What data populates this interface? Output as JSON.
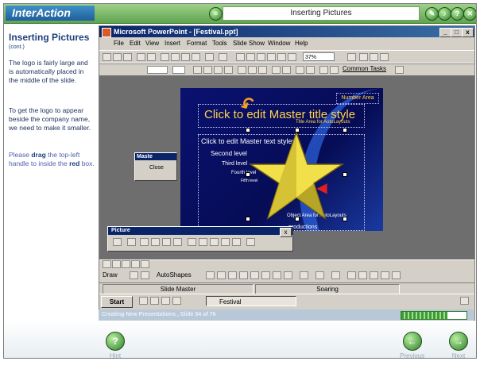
{
  "app": {
    "brand": "InterAction",
    "lesson_title": "Inserting Pictures"
  },
  "top_icons": [
    "pin-icon",
    "audio-icon",
    "help-icon",
    "close-icon"
  ],
  "left_panel": {
    "title": "Inserting Pictures",
    "subtitle": "(cont.)",
    "para1": "The logo is fairly large and is automatically placed in the middle of the slide.",
    "para2": "To get the logo to appear beside the company name, we need to make it smaller.",
    "para3_prefix": "Please ",
    "para3_drag": "drag",
    "para3_mid": " the top-left handle to inside the ",
    "para3_red": "red",
    "para3_end": " box."
  },
  "ppt": {
    "title": "Microsoft PowerPoint - [Festival.ppt]",
    "menu": [
      "File",
      "Edit",
      "View",
      "Insert",
      "Format",
      "Tools",
      "Slide Show",
      "Window",
      "Help"
    ],
    "zoom": "37%",
    "common_tasks": "Common Tasks"
  },
  "slide": {
    "number_area": "Number Area",
    "title": "Click to edit Master title style",
    "title_area": "Title Area for AutoLayouts",
    "bullets": [
      "Click to edit Master text styles",
      "Second level",
      "Third level",
      "Fourth level",
      "Fifth level"
    ],
    "object_area": "Object Area for AutoLayouts",
    "footer_text": "productions"
  },
  "master_toolbar": {
    "title": "Maste",
    "close_label": "Close"
  },
  "picture_toolbar": {
    "title": "Picture"
  },
  "draw_toolbar": {
    "draw_label": "Draw",
    "autoshapes_label": "AutoShapes"
  },
  "statusbar": {
    "view": "Slide Master",
    "design": "Soaring"
  },
  "taskbar": {
    "start": "Start",
    "festival": "Festival"
  },
  "progress": {
    "text": "Creating New Presentations , Slide 54 of 76",
    "fraction": 0.71
  },
  "nav": {
    "hint": "Hint",
    "previous": "Previous",
    "next": "Next"
  }
}
